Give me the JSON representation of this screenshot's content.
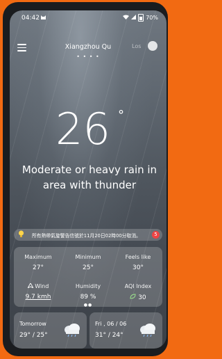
{
  "status": {
    "time": "04:42",
    "battery": "70%",
    "icons": [
      "cat-icon",
      "wifi-icon",
      "signal-icon",
      "battery-icon"
    ]
  },
  "header": {
    "city": "Xiangzhou Qu",
    "page_dots": "• • • •",
    "toggle_label": "Los"
  },
  "weather": {
    "temperature": "26",
    "degree": "°",
    "condition": "Moderate or heavy rain in area with thunder"
  },
  "notice": {
    "text": "所有熱帶氣旋警告信號於11月20日02時00分取消。",
    "badge": "5"
  },
  "stats": {
    "maximum_label": "Maximum",
    "maximum_value": "27°",
    "minimum_label": "Minimum",
    "minimum_value": "25°",
    "feels_label": "Feels like",
    "feels_value": "30°",
    "wind_label": "Wind",
    "wind_value": "9.7 kmh",
    "humidity_label": "Humidity",
    "humidity_value": "89 %",
    "aqi_label": "AQI Index",
    "aqi_value": "30"
  },
  "forecast": [
    {
      "day": "Tomorrow",
      "temps": "29° / 25°"
    },
    {
      "day": "Fri , 06 / 06",
      "temps": "31° / 24°"
    }
  ],
  "colors": {
    "background": "#f26a12",
    "accent": "#ffd54a",
    "badge": "#e44444"
  }
}
